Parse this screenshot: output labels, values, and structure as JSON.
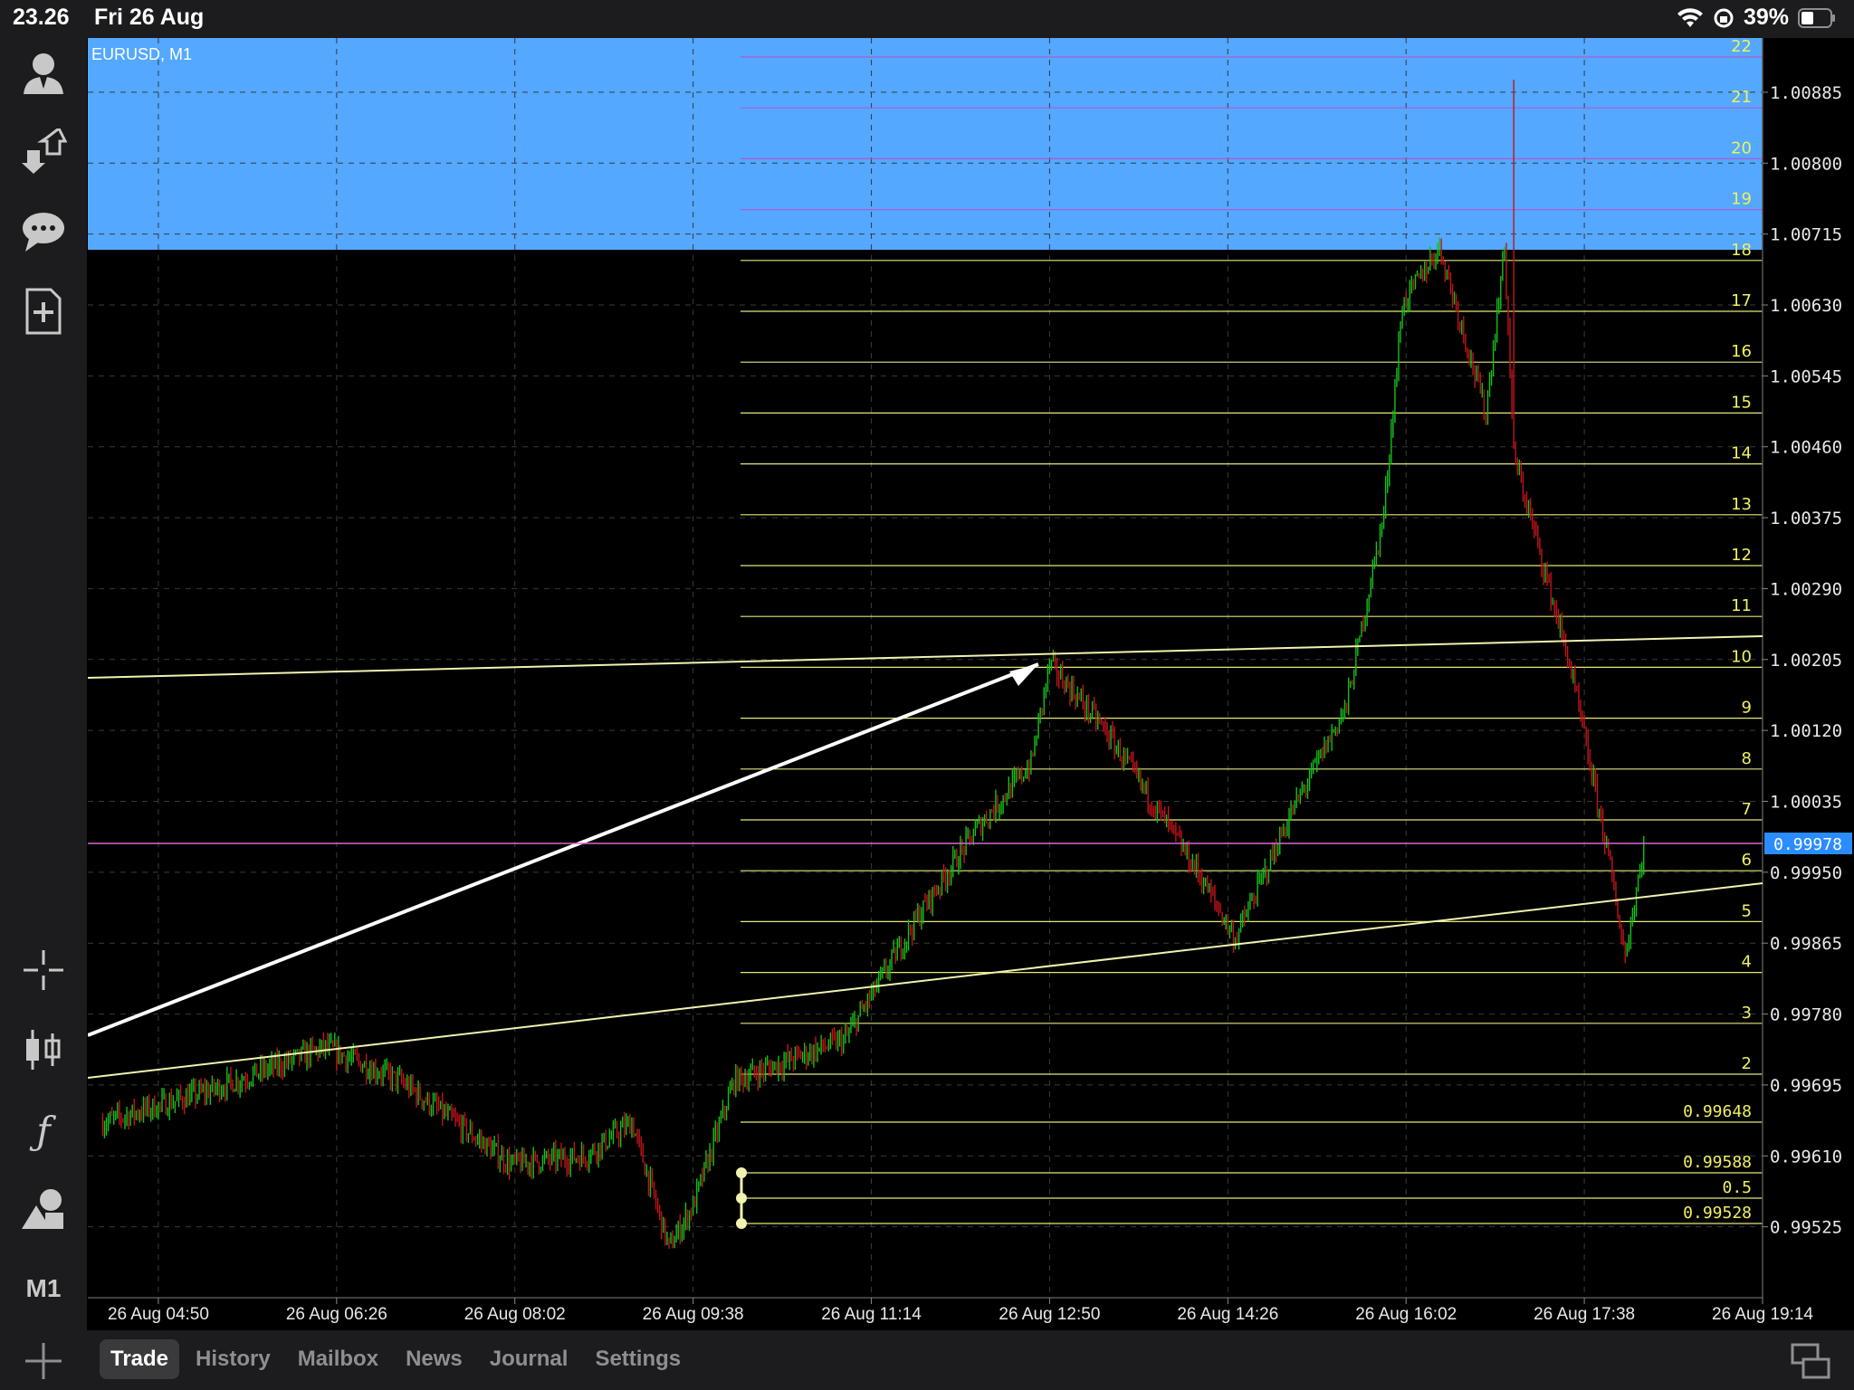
{
  "status_bar": {
    "time": "23.26",
    "date": "Fri 26 Aug",
    "battery": "39%"
  },
  "sidebar": {
    "items": [
      {
        "name": "account-icon"
      },
      {
        "name": "trade-arrows-icon"
      },
      {
        "name": "chat-icon"
      },
      {
        "name": "new-order-icon"
      },
      {
        "name": "crosshair-icon"
      },
      {
        "name": "chart-type-icon"
      },
      {
        "name": "indicators-icon"
      },
      {
        "name": "objects-icon"
      }
    ],
    "timeframe": "M1"
  },
  "chart": {
    "symbol_label": "EURUSD, M1",
    "current_price": "0.99978",
    "colors": {
      "up_candle": "#14c01a",
      "down_candle": "#c0141a",
      "fib_line": "#e6e67a",
      "zone": "#54a8ff",
      "bid_line": "#d06ad0",
      "axis_text": "#e8e8e8"
    }
  },
  "chart_data": {
    "type": "candlestick",
    "symbol": "EURUSD",
    "timeframe": "M1",
    "y_ticks": [
      "1.00885",
      "1.00800",
      "1.00715",
      "1.00630",
      "1.00545",
      "1.00460",
      "1.00375",
      "1.00290",
      "1.00205",
      "1.00120",
      "1.00035",
      "0.99950",
      "0.99865",
      "0.99780",
      "0.99695",
      "0.99610",
      "0.99525"
    ],
    "x_ticks": [
      "26 Aug 04:50",
      "26 Aug 06:26",
      "26 Aug 08:02",
      "26 Aug 09:38",
      "26 Aug 11:14",
      "26 Aug 12:50",
      "26 Aug 14:26",
      "26 Aug 16:02",
      "26 Aug 17:38",
      "26 Aug 19:14"
    ],
    "fib_levels": [
      "22",
      "21",
      "20",
      "19",
      "18",
      "17",
      "16",
      "15",
      "14",
      "13",
      "12",
      "11",
      "10",
      "9",
      "8",
      "7",
      "6",
      "5",
      "4",
      "3",
      "2"
    ],
    "fib_price_labels": [
      "0.99648",
      "0.99588",
      "0.5",
      "0.99528"
    ],
    "price_path": [
      [
        "26 Aug 04:20",
        0.9965
      ],
      [
        "26 Aug 05:20",
        0.9969
      ],
      [
        "26 Aug 06:20",
        0.9974
      ],
      [
        "26 Aug 07:00",
        0.997
      ],
      [
        "26 Aug 08:00",
        0.996
      ],
      [
        "26 Aug 08:40",
        0.9961
      ],
      [
        "26 Aug 09:05",
        0.9965
      ],
      [
        "26 Aug 09:25",
        0.995
      ],
      [
        "26 Aug 09:38",
        0.9955
      ],
      [
        "26 Aug 10:00",
        0.997
      ],
      [
        "26 Aug 11:00",
        0.9975
      ],
      [
        "26 Aug 11:40",
        0.999
      ],
      [
        "26 Aug 12:10",
        1.0
      ],
      [
        "26 Aug 12:40",
        1.0008
      ],
      [
        "26 Aug 12:50",
        1.002
      ],
      [
        "26 Aug 13:20",
        1.0012
      ],
      [
        "26 Aug 14:10",
        0.9995
      ],
      [
        "26 Aug 14:30",
        0.9987
      ],
      [
        "26 Aug 15:00",
        1.0002
      ],
      [
        "26 Aug 15:30",
        1.0015
      ],
      [
        "26 Aug 15:50",
        1.0038
      ],
      [
        "26 Aug 16:00",
        1.0063
      ],
      [
        "26 Aug 16:20",
        1.007
      ],
      [
        "26 Aug 16:45",
        1.005
      ],
      [
        "26 Aug 16:55",
        1.007
      ],
      [
        "26 Aug 17:00",
        1.0045
      ],
      [
        "26 Aug 17:30",
        1.002
      ],
      [
        "26 Aug 17:50",
        0.9998
      ],
      [
        "26 Aug 18:00",
        0.9985
      ],
      [
        "26 Aug 18:10",
        0.9998
      ]
    ],
    "high_wick": [
      "26 Aug 17:00",
      1.009
    ],
    "ylim": [
      0.9944,
      1.0095
    ],
    "xlim": [
      "26 Aug 04:12",
      "26 Aug 19:14"
    ]
  },
  "bottom_bar": {
    "tabs": [
      {
        "label": "Trade",
        "active": true
      },
      {
        "label": "History",
        "active": false
      },
      {
        "label": "Mailbox",
        "active": false
      },
      {
        "label": "News",
        "active": false
      },
      {
        "label": "Journal",
        "active": false
      },
      {
        "label": "Settings",
        "active": false
      }
    ]
  }
}
